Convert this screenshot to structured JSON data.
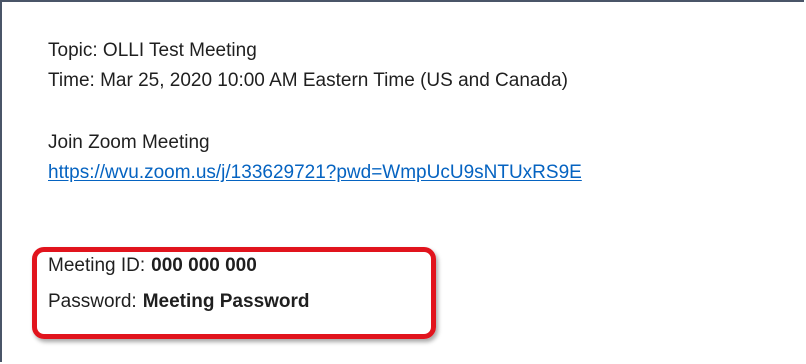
{
  "invite": {
    "topic": "Topic: OLLI Test Meeting",
    "time": "Time: Mar 25, 2020 10:00 AM Eastern Time (US and Canada)",
    "join_label": "Join Zoom Meeting",
    "join_link": "https://wvu.zoom.us/j/133629721?pwd=WmpUcU9sNTUxRS9E",
    "meeting_id_label": "Meeting ID:",
    "meeting_id_value": "000 000 000",
    "password_label": "Password:",
    "password_value": "Meeting Password"
  },
  "colors": {
    "highlight_border": "#e1141d",
    "link": "#0563c1",
    "text": "#1f1f1f"
  }
}
